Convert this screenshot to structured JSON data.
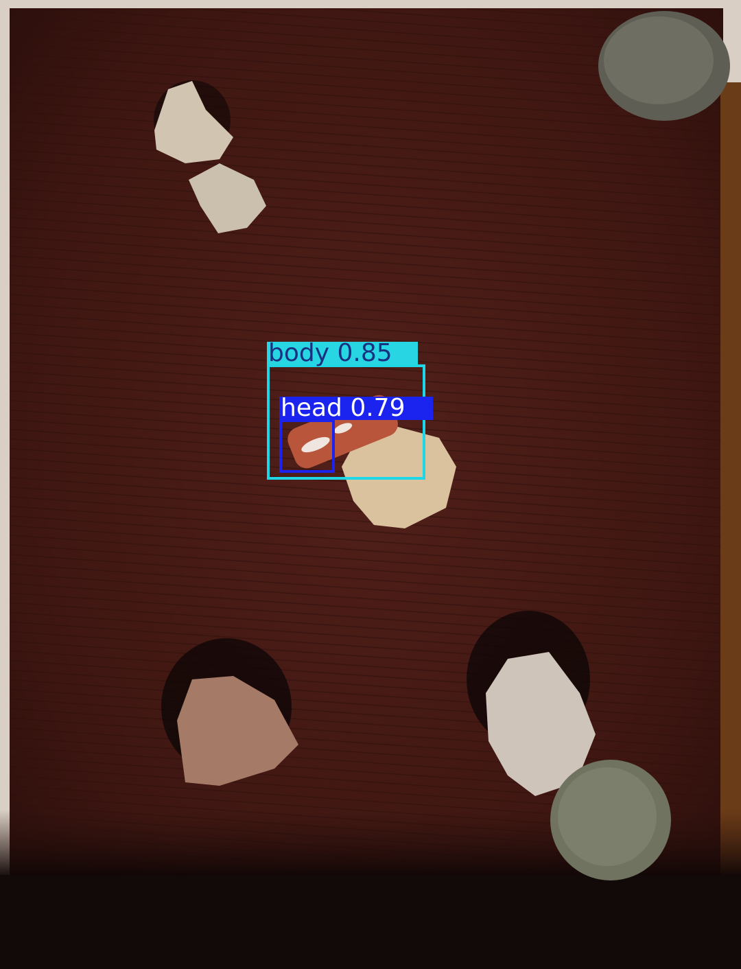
{
  "scene": {
    "colors": {
      "floor": "#4a1a14",
      "floor_dark": "#2a100c",
      "border": "#e8dcd0",
      "shadow": "#120808"
    }
  },
  "detections": [
    {
      "class_label": "body 0.85",
      "color": "#1fd6e6"
    },
    {
      "class_label": "head 0.79",
      "color": "#1b24ee"
    }
  ]
}
